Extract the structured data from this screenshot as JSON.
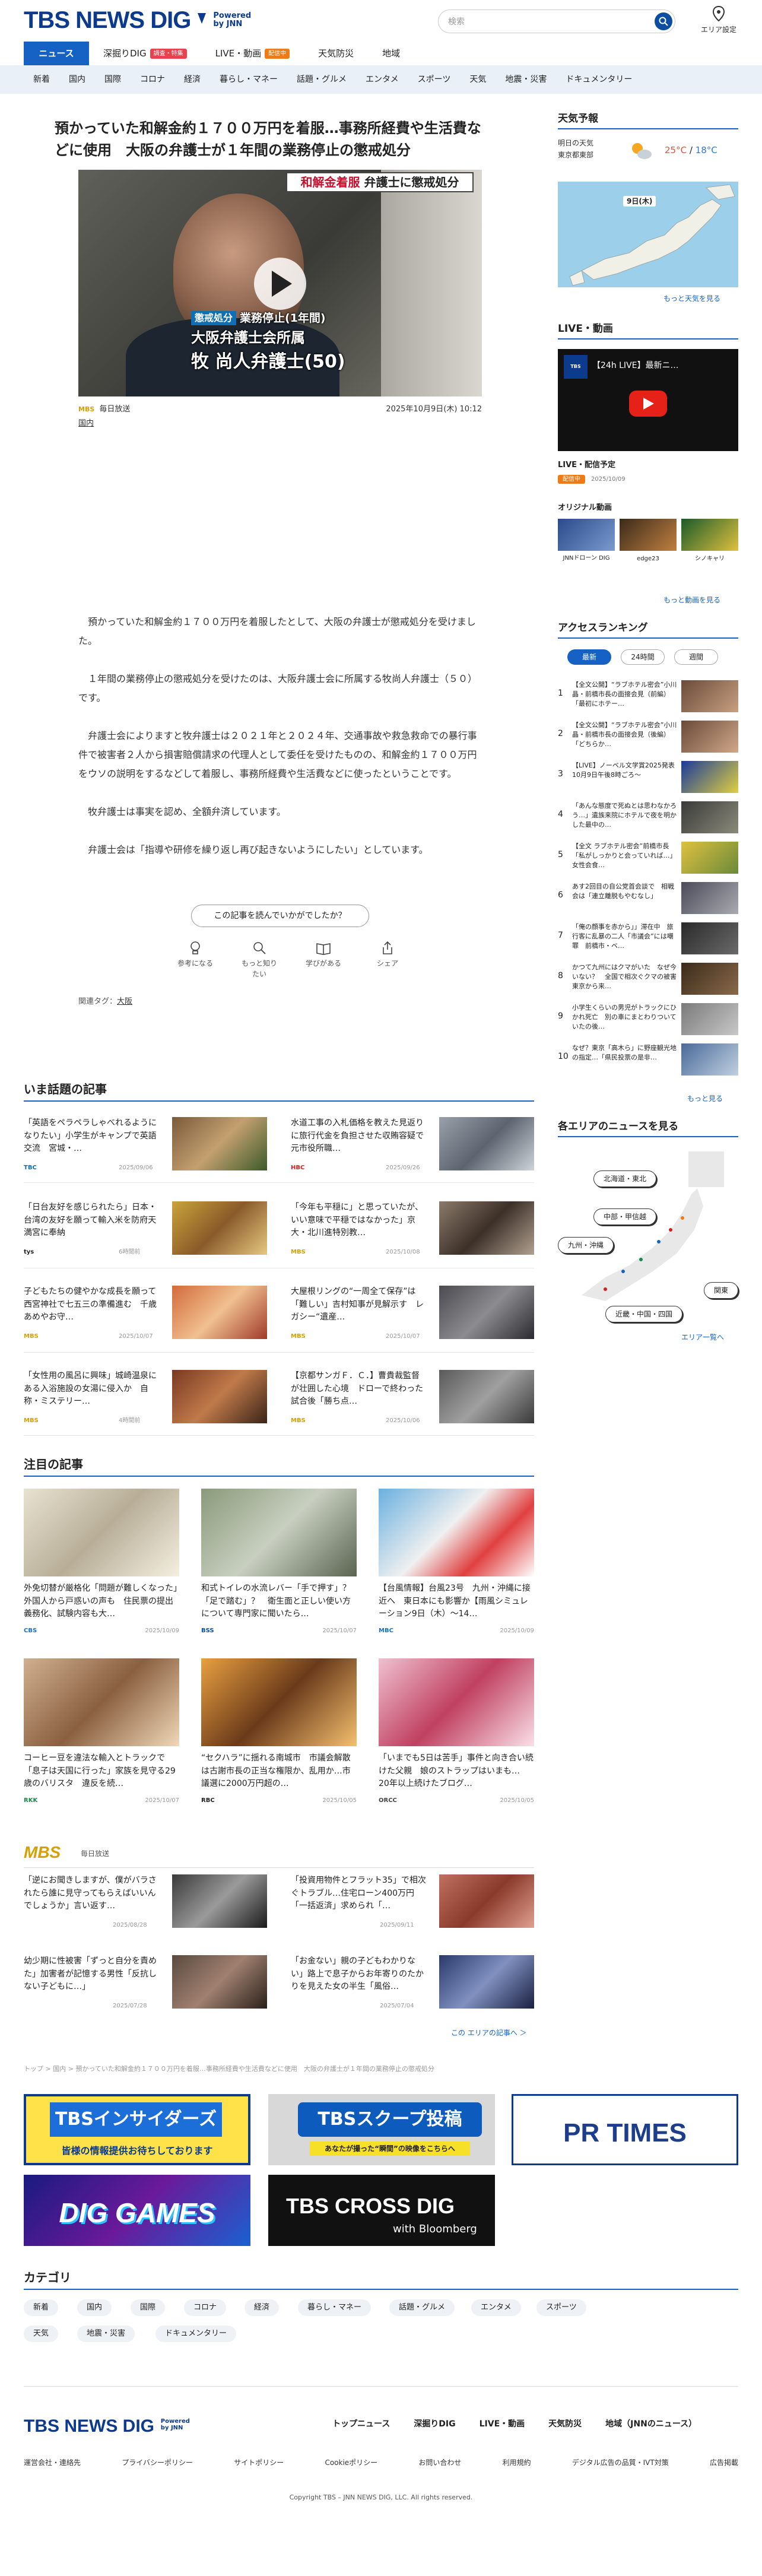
{
  "header": {
    "logo_text": "TBS NEWS DIG",
    "logo_sub_top": "Powered",
    "logo_sub_bottom": "by JNN",
    "search_placeholder": "検索",
    "area_setting_label": "エリア設定"
  },
  "nav_top": [
    {
      "label": "ニュース",
      "active": true
    },
    {
      "label": "深掘りDIG",
      "badge": "調査・特集"
    },
    {
      "label": "LIVE・動画",
      "badge": "配信中"
    },
    {
      "label": "天気防災"
    },
    {
      "label": "地域"
    }
  ],
  "nav_sub": [
    "新着",
    "国内",
    "国際",
    "コロナ",
    "経済",
    "暮らし・マネー",
    "話題・グルメ",
    "エンタメ",
    "スポーツ",
    "天気",
    "地震・災害",
    "ドキュメンタリー"
  ],
  "article": {
    "title": "預かっていた和解金約１７００万円を着服…事務所経費や生活費などに使用　大阪の弁護士が１年間の業務停止の懲戒処分",
    "hero": {
      "banner_top_red": "和解金着服",
      "banner_top_rest": " 弁護士に懲戒処分",
      "tag": "懲戒処分",
      "line1": "業務停止(1年間)",
      "line2": "大阪弁護士会所属",
      "line3": "牧 尚人弁護士(50)"
    },
    "source_badge": "MBS",
    "source": "毎日放送",
    "date": "2025年10月9日(木) 10:12",
    "category": "国内",
    "paragraphs": [
      "預かっていた和解金約１７００万円を着服したとして、大阪の弁護士が懲戒処分を受けました。",
      "１年間の業務停止の懲戒処分を受けたのは、大阪弁護士会に所属する牧尚人弁護士（５０）です。",
      "弁護士会によりますと牧弁護士は２０２１年と２０２４年、交通事故や救急救命での暴行事件で被害者２人から損害賠償請求の代理人として委任を受けたものの、和解金約１７００万円をウソの説明をするなどして着服し、事務所経費や生活費などに使ったということです。",
      "牧弁護士は事実を認め、全額弁済しています。",
      "弁護士会は「指導や研修を繰り返し再び起きないようにしたい」としています。"
    ],
    "feedback_question": "この記事を読んでいかがでしたか？",
    "feedback_options": [
      "参考になる",
      "もっと知りたい",
      "学びがある",
      "シェア"
    ],
    "tags_label": "関連タグ：",
    "tags": [
      "大阪"
    ]
  },
  "trending": {
    "title": "いま話題の記事",
    "items": [
      {
        "text": "「英語をペラペラしゃべれるようになりたい」小学生がキャンプで英語交流　宮城・…",
        "source": "TBC",
        "date": "2025/09/06"
      },
      {
        "text": "水道工事の入札価格を教えた見返りに旅行代金を負担させた収賄容疑で　元市役所職…",
        "source": "HBC",
        "date": "2025/09/26"
      },
      {
        "text": "「日台友好を感じられたら」日本・台湾の友好を願って輸入米を防府天満宮に奉納",
        "source": "tys",
        "date": "6時間前"
      },
      {
        "text": "「今年も平穏に」と思っていたが、いい意味で平穏ではなかった」京大・北川進特別教…",
        "source": "MBS",
        "date": "2025/10/08"
      },
      {
        "text": "子どもたちの健やかな成長を願って　西宮神社で七五三の準備進む　千歳あめやお守…",
        "source": "MBS",
        "date": "2025/10/07"
      },
      {
        "text": "大屋根リングの“一周全て保存”は「難しい」吉村知事が見解示す　レガシー“遺産…",
        "source": "MBS",
        "date": "2025/10/07"
      },
      {
        "text": "「女性用の風呂に興味」城崎温泉にある入浴施設の女湯に侵入か　自称・ミステリー…",
        "source": "MBS",
        "date": "4時間前"
      },
      {
        "text": "【京都サンガＦ．Ｃ．】曹貴裁監督が壮囲した心境　ドローで終わった試合後「勝ち点…",
        "source": "MBS",
        "date": "2025/10/06"
      }
    ]
  },
  "featured": {
    "title": "注目の記事",
    "items": [
      {
        "text": "外免切替が厳格化「問題が難しくなった」外国人から戸惑いの声も　住民票の提出義務化、試験内容も大…",
        "source": "CBS",
        "date": "2025/10/09"
      },
      {
        "text": "和式トイレの水流レバー「手で押す」？「足で踏む」？　衛生面と正しい使い方について専門家に聞いたら…",
        "source": "BSS",
        "date": "2025/10/07"
      },
      {
        "text": "【台風情報】台風23号　九州・沖縄に接近へ　東日本にも影響か【雨風シミュレーション9日（木）〜14…",
        "source": "MBC",
        "date": "2025/10/09"
      },
      {
        "text": "コーヒー豆を違法な輸入とトラックで「息子は天国に行った」家族を見守る29歳のバリスタ　違反を続…",
        "source": "RKK",
        "date": "2025/10/07"
      },
      {
        "text": "“セクハラ”に揺れる南城市　市議会解散は古謝市長の正当な権限か、乱用か…市議選に2000万円超の…",
        "source": "RBC",
        "date": "2025/10/05"
      },
      {
        "text": "「いまでも5日は苦手」事件と向き合い続けた父親　娘のストラップはいまも…　20年以上続けたブログ…",
        "source": "ORCC",
        "date": "2025/10/05"
      }
    ]
  },
  "mbs_section": {
    "label": "毎日放送",
    "items": [
      {
        "text": "「逆にお聞きしますが、僕がバラされたら誰に見守ってもらえばいいんでしょうか」言い返す…",
        "date": "2025/08/28"
      },
      {
        "text": "「投資用物件とフラット35」で相次ぐトラブル…住宅ローン400万円「一括返済」求められ「…",
        "date": "2025/09/11"
      },
      {
        "text": "幼少期に性被害「ずっと自分を責めた」加害者が記憶する男性「反抗しない子どもに…」",
        "date": "2025/07/28"
      },
      {
        "text": "「お金ない」親の子どもわかりない」路上で息子からお年寄りのたかりを見えた女の半生「風俗…",
        "date": "2025/07/04"
      }
    ],
    "more": "この エリアの記事へ ＞"
  },
  "breadcrumb": "トップ > 国内 > 預かっていた和解金約１７００万円を着服…事務所経費や生活費などに使用　大阪の弁護士が１年間の業務停止の懲戒処分",
  "banners": {
    "insiders_title": "TBSインサイダーズ",
    "insiders_sub": "皆様の情報提供お待ちしております",
    "scoop_title": "TBSスクープ投稿",
    "scoop_sub": "あなたが撮った“瞬間”の映像をこちらへ",
    "prtimes": "PR TIMES",
    "diggames": "DIG GAMES",
    "crossdig": "TBS CROSS DIG",
    "crossdig_sub": "with Bloomberg"
  },
  "categories": {
    "title": "カテゴリ",
    "items": [
      "新着",
      "国内",
      "国際",
      "コロナ",
      "経済",
      "暮らし・マネー",
      "話題・グルメ",
      "エンタメ",
      "スポーツ",
      "天気",
      "地震・災害",
      "ドキュメンタリー"
    ]
  },
  "footer": {
    "nav": [
      "トップニュース",
      "深掘りDIG",
      "LIVE・動画",
      "天気防災",
      "地域（JNNのニュース）"
    ],
    "links": [
      "運営会社・連絡先",
      "プライバシーポリシー",
      "サイトポリシー",
      "Cookieポリシー",
      "お問い合わせ",
      "利用規約",
      "デジタル広告の品質・IVT対策",
      "広告掲載"
    ],
    "copyright": "Copyright TBS – JNN NEWS DIG, LLC. All rights reserved."
  },
  "sidebar": {
    "weather": {
      "title": "天気予報",
      "day": "明日の天気",
      "region": "東京都東部",
      "high": "25°C",
      "low": "18°C",
      "map_label": "9日(木)",
      "more": "もっと天気を見る"
    },
    "live": {
      "title": "LIVE・動画",
      "player_title": "【24h LIVE】最新ニ…",
      "schedule_title": "LIVE・配信予定",
      "schedule_badge": "配信中",
      "schedule_date": "2025/10/09",
      "original_title": "オリジナル動画",
      "originals": [
        "JNNドローン DIG",
        "edge23",
        "シノキャリ"
      ],
      "more": "もっと動画を見る"
    },
    "ranking": {
      "title": "アクセスランキング",
      "tabs": [
        "最新",
        "24時間",
        "週間"
      ],
      "items": [
        {
          "num": "1",
          "text": "【全文公開】“ラブホテル密会”小川晶・前橋市長の面接会見（前編）「最初にホテー…"
        },
        {
          "num": "2",
          "text": "【全文公開】“ラブホテル密会”小川晶・前橋市長の面接会見（後編）「どちらか…"
        },
        {
          "num": "3",
          "text": "【LIVE】ノーベル文学賞2025発表　10月9日午後8時ごろ～"
        },
        {
          "num": "4",
          "text": "「あんな態度で死ぬとは思わなかろう…」遺族来院にホテルで夜を明かした最中の…"
        },
        {
          "num": "5",
          "text": "【全文 ラブホテル密会”前橋市長「私がしっかりと会っていれば…」 女性会食…"
        },
        {
          "num": "6",
          "text": "あす2回目の自公党首会談で　相戦会は「連立離脱もやむなし」"
        },
        {
          "num": "7",
          "text": "「俺の顔事を赤から」」滞在中　旅行客に乱暴の二人「市議会”には嘲罪　前橋市・ベ…"
        },
        {
          "num": "8",
          "text": "かつて九州にはクマがいた　なぜ今いない？　全国で相次ぐクマの被害　東京から来…"
        },
        {
          "num": "9",
          "text": "小学生くらいの男児がトラックにひかれ死亡　別の車にまとわりついていたの後…"
        },
        {
          "num": "10",
          "text": "なぜ？東京「高木ら」に野座観光地の指定…「県民投票の是非…"
        }
      ],
      "more": "もっと見る"
    },
    "areas": {
      "title": "各エリアのニュースを見る",
      "buttons": [
        "北海道・東北",
        "中部・甲信越",
        "九州・沖縄",
        "関東",
        "近畿・中国・四国"
      ],
      "more": "エリア一覧へ"
    }
  }
}
